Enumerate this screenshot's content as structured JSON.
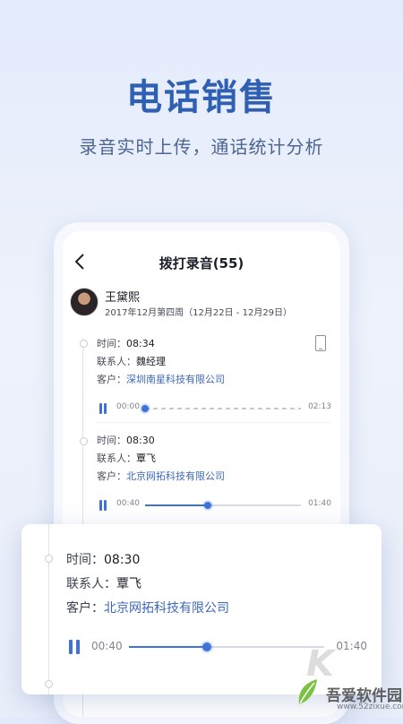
{
  "hero": {
    "title": "电话销售",
    "subtitle": "录音实时上传，通话统计分析"
  },
  "screen": {
    "title": "拨打录音(55)",
    "user": {
      "name": "王黛熙",
      "week": "2017年12月第四周（12月22日 - 12月29日）"
    },
    "labels": {
      "time": "时间：",
      "contact": "联系人：",
      "customer": "客户："
    },
    "records": [
      {
        "time": "08:34",
        "contact": "魏经理",
        "customer": "深圳南星科技有限公司",
        "elapsed": "00:00",
        "duration": "02:13",
        "progress": 0
      },
      {
        "time": "08:30",
        "contact": "覃飞",
        "customer": "北京网拓科技有限公司",
        "elapsed": "00:40",
        "duration": "01:40",
        "progress": 0.4
      }
    ]
  },
  "popup": {
    "time": "08:30",
    "contact": "覃飞",
    "customer": "北京网拓科技有限公司",
    "elapsed": "00:40",
    "duration": "01:40",
    "progress": 0.4
  },
  "watermark": {
    "brand": "吾爱软件园",
    "url": "www.52zixue.com"
  },
  "colors": {
    "accent": "#3e72d6",
    "title": "#2f5fb3",
    "company": "#3d68b8"
  }
}
